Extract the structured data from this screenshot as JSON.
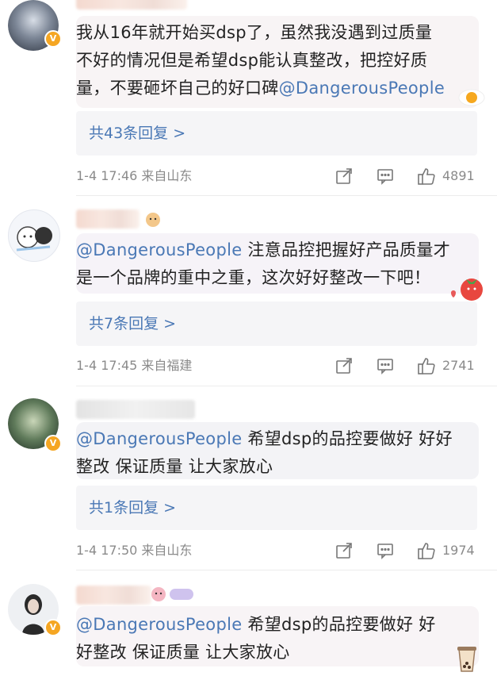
{
  "comments": [
    {
      "lines": [
        "我从16年就开始买dsp了，虽然我没遇到过质量",
        "不好的情况但是希望dsp能认真整改，把控好质",
        "量，不要砸坏自己的好口碑"
      ],
      "mention": "@DangerousPeople",
      "reply_label": "共43条回复 >",
      "time": "1-4 17:46 来自山东",
      "likes": "4891",
      "verified_badge": "V"
    },
    {
      "mention": "@DangerousPeople",
      "line1_rest": " 注意品控把握好产品质量才",
      "line2": "是一个品牌的重中之重，这次好好整改一下吧！",
      "reply_label": "共7条回复 >",
      "time": "1-4 17:45 来自福建",
      "likes": "2741"
    },
    {
      "mention": "@DangerousPeople",
      "line1_rest": " 希望dsp的品控要做好 好好",
      "line2": "整改 保证质量 让大家放心",
      "reply_label": "共1条回复 >",
      "time": "1-4 17:50 来自山东",
      "likes": "1974",
      "verified_badge": "V"
    },
    {
      "mention": "@DangerousPeople",
      "line1_rest": " 希望dsp的品控要做好 好",
      "line2": "好整改 保证质量 让大家放心",
      "verified_badge": "V"
    }
  ],
  "icons": [
    "share-icon",
    "comment-icon",
    "like-icon"
  ],
  "colors": {
    "mention": "#4a78b5",
    "meta": "#8a8a8a",
    "badge": "#f5a623",
    "bubble": "#f3f3f7"
  }
}
